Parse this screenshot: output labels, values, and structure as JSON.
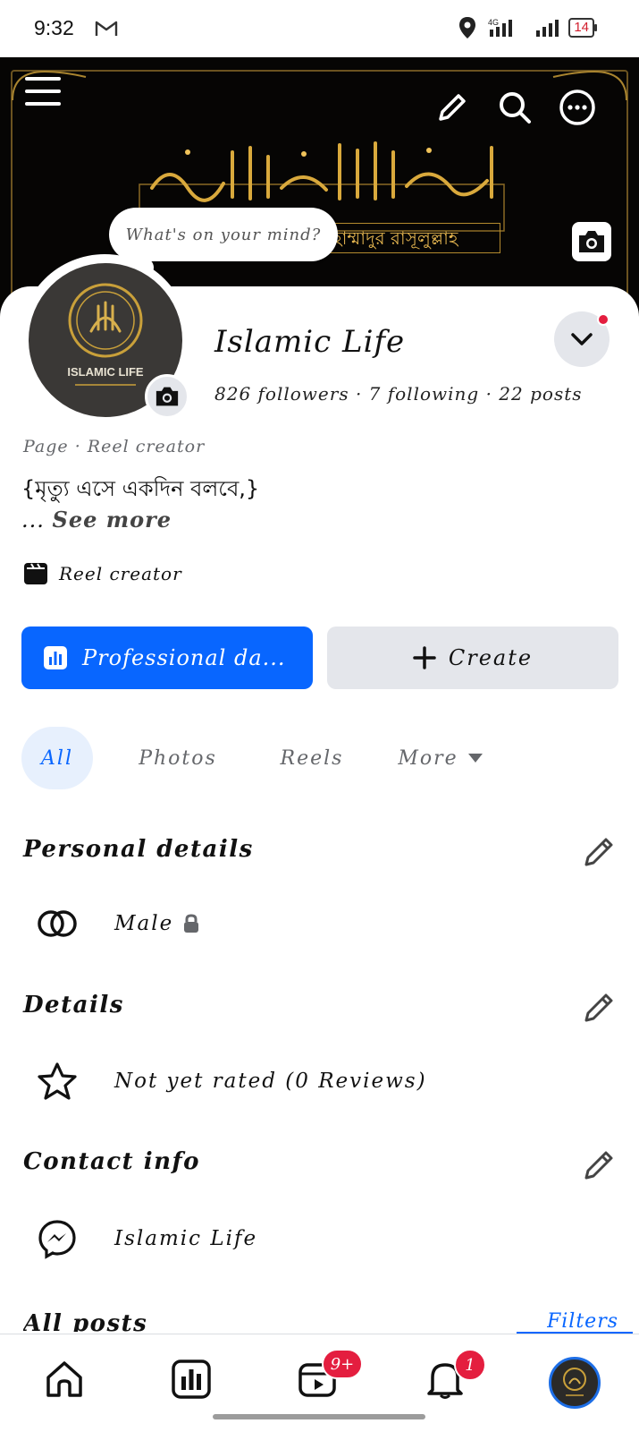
{
  "status_bar": {
    "time": "9:32",
    "network": "4G",
    "battery": "14"
  },
  "cover": {
    "bubble_text": "What's on your mind?",
    "bangla_caption": "মুহাম্মাদুর রাসূলুল্লাহ",
    "icons": [
      "menu-icon",
      "pencil-icon",
      "search-icon",
      "more-icon",
      "camera-icon"
    ]
  },
  "profile": {
    "name": "Islamic Life",
    "stats": "826 followers · 7 following · 22 posts",
    "category": "Page · Reel creator",
    "bio": "{মৃত্যু এসে একদিন বলবে,}",
    "see_more_prefix": "...",
    "see_more": "See more",
    "reel_creator": "Reel creator",
    "avatar_logo_text": "ISLAMIC LIFE"
  },
  "actions": {
    "professional": "Professional da...",
    "create": "Create"
  },
  "tabs": [
    "All",
    "Photos",
    "Reels",
    "More"
  ],
  "sections": {
    "personal_details": {
      "title": "Personal details",
      "gender": "Male"
    },
    "details": {
      "title": "Details",
      "rating": "Not yet rated (0 Reviews)"
    },
    "contact_info": {
      "title": "Contact info",
      "messenger": "Islamic Life"
    }
  },
  "posts": {
    "title": "All posts",
    "filters": "Filters"
  },
  "bottom_nav": {
    "items": [
      "home-icon",
      "dashboard-icon",
      "video-icon",
      "bell-icon",
      "profile-avatar"
    ],
    "video_badge": "9+",
    "notif_badge": "1"
  },
  "colors": {
    "accent": "#0866ff",
    "badge": "#e41e3f",
    "chip_bg": "#e4e6eb",
    "gold": "#c9a03a"
  }
}
